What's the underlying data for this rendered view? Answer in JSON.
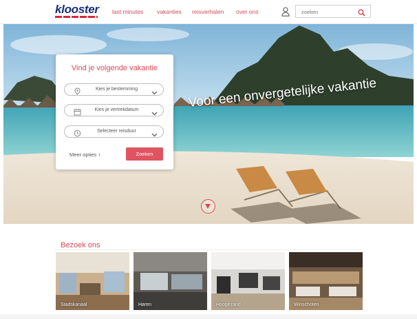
{
  "header": {
    "logo_text": "klooster",
    "nav": [
      {
        "label": "last minutes"
      },
      {
        "label": "vakanties"
      },
      {
        "label": "reisverhalen"
      },
      {
        "label": "over ons"
      }
    ],
    "user_icon": "user-icon",
    "search": {
      "placeholder": "zoeken",
      "icon": "search-icon"
    }
  },
  "hero": {
    "title": "Voor een onvergetelijke vakantie",
    "scroll_icon": "arrow-down-icon"
  },
  "search_card": {
    "title": "Vind je volgende vakantie",
    "fields": [
      {
        "label": "Kies je bestemming",
        "icon": "location-pin-icon"
      },
      {
        "label": "Kies je vertrekdatum",
        "icon": "calendar-icon"
      },
      {
        "label": "Selecteer reisduur",
        "icon": "clock-icon"
      }
    ],
    "more_options": "Meer opties",
    "submit": "Zoeken"
  },
  "visit": {
    "title": "Bezoek ons",
    "locations": [
      {
        "name": "Stadskanaal"
      },
      {
        "name": "Haren"
      },
      {
        "name": "Hoogezand"
      },
      {
        "name": "Winschoten"
      }
    ]
  },
  "colors": {
    "accent": "#d94a54",
    "button": "#e05361",
    "logo_blue": "#1a2f7a"
  }
}
